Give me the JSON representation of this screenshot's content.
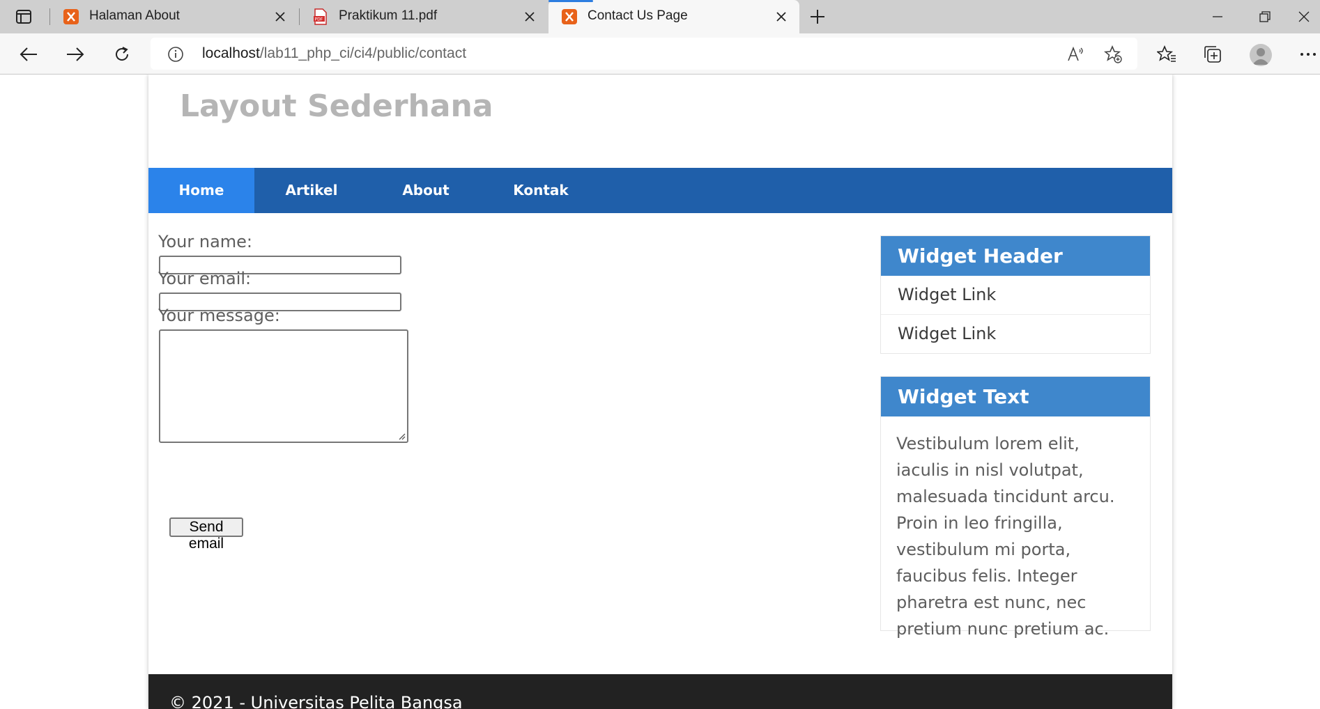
{
  "browser": {
    "tabs": [
      {
        "title": "Halaman About",
        "icon": "codeigniter-favicon-icon"
      },
      {
        "title": "Praktikum 11.pdf",
        "icon": "pdf-favicon-icon"
      },
      {
        "title": "Contact Us Page",
        "icon": "codeigniter-favicon-icon",
        "active": true
      }
    ],
    "url_host": "localhost",
    "url_path": "/lab11_php_ci/ci4/public/contact",
    "accent_color": "#2d7de0"
  },
  "site": {
    "title": "Layout Sederhana",
    "nav": [
      "Home",
      "Artikel",
      "About",
      "Kontak"
    ],
    "nav_active": "Home",
    "colors": {
      "nav_bg": "#1f5faa",
      "nav_active": "#2b83ea",
      "widget_header": "#3f87cc",
      "footer_bg": "#222222"
    }
  },
  "form": {
    "name_label": "Your name:",
    "name_value": "",
    "email_label": "Your email:",
    "email_value": "",
    "message_label": "Your message:",
    "message_value": "",
    "submit_label": "Send email"
  },
  "sidebar": {
    "widget1": {
      "header": "Widget Header",
      "links": [
        "Widget Link",
        "Widget Link"
      ]
    },
    "widget2": {
      "header": "Widget Text",
      "text": "Vestibulum lorem elit, iaculis in nisl volutpat, malesuada tincidunt arcu. Proin in leo fringilla, vestibulum mi porta, faucibus felis. Integer pharetra est nunc, nec pretium nunc pretium ac."
    }
  },
  "footer": {
    "text": "© 2021 - Universitas Pelita Bangsa"
  }
}
